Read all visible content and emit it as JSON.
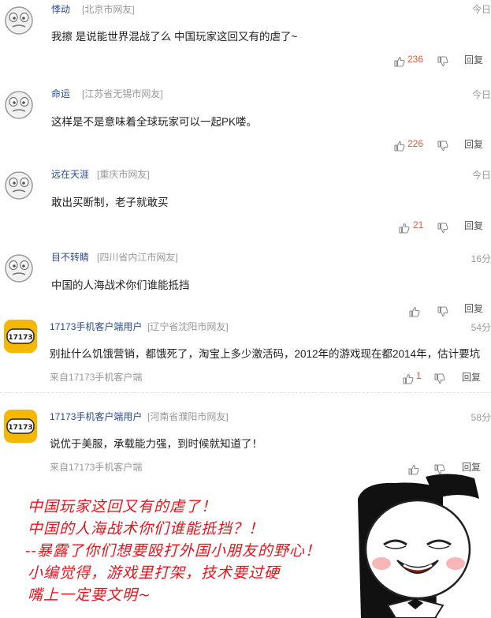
{
  "comments": [
    {
      "name": "悸动",
      "location": "[北京市网友]",
      "time": "今日",
      "text": "我擦 是说能世界混战了么 中国玩家这回又有的虐了~",
      "likes": "236",
      "reply": "回复",
      "avatar": "default-face-icon"
    },
    {
      "name": "命运",
      "location": "[江苏省无锡市网友]",
      "time": "今日",
      "text": "这样是不是意味着全球玩家可以一起PK喽。",
      "likes": "226",
      "reply": "回复",
      "avatar": "default-face-icon"
    },
    {
      "name": "远在天涯",
      "location": "[重庆市网友]",
      "time": "今日",
      "text": "敢出买断制，老子就敢买",
      "likes": "21",
      "reply": "回复",
      "avatar": "default-face-icon"
    },
    {
      "name": "目不转睛",
      "location": "[四川省内江市网友]",
      "time": "16分",
      "text": "中国的人海战术你们谁能抵挡",
      "likes": "",
      "reply": "回复",
      "avatar": "default-face-icon"
    },
    {
      "name": "17173手机客户端用户",
      "location": "[辽宁省沈阳市网友]",
      "time": "54分",
      "text": "别扯什么饥饿营销，都饿死了，淘宝上多少激活码，2012年的游戏现在都2014年，估计要坑",
      "from": "来自17173手机客户端",
      "likes": "1",
      "reply": "回复",
      "avatar": "17173-app-icon"
    },
    {
      "name": "17173手机客户端用户",
      "location": "[河南省濮阳市网友]",
      "time": "58分",
      "text": "说优于美服，承载能力强，到时候就知道了！",
      "from": "来自17173手机客户端",
      "likes": "",
      "reply": "回复",
      "avatar": "17173-app-icon"
    }
  ],
  "app_logo_text": "17173",
  "handwriting": [
    "中国玩家这回又有的虐了！",
    "中国的人海战术你们谁能抵挡？！",
    "--暴露了你们想要殴打外国小朋友的野心！",
    "小编觉得，游戏里打架，技术要过硬",
    "嘴上一定要文明~"
  ],
  "colors": {
    "name": "#2b4c8c",
    "location": "#999999",
    "likes": "#e05a3a",
    "handwriting": "#e8141c",
    "app_icon_bg": "#f5b800"
  }
}
